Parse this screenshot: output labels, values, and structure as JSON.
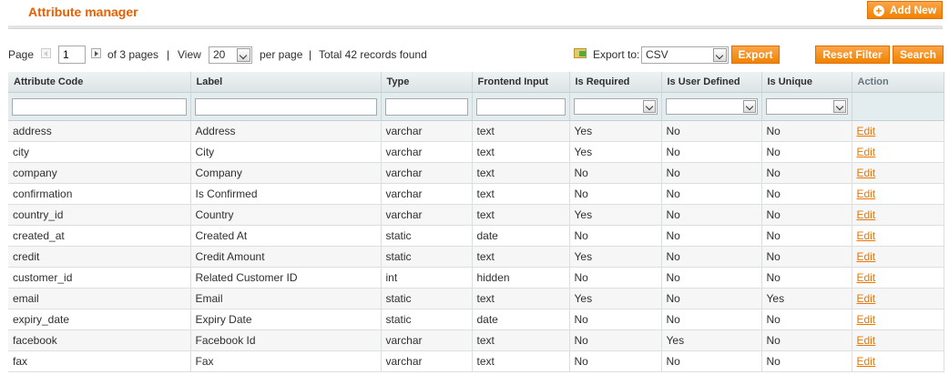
{
  "header": {
    "title": "Attribute manager",
    "add_new_label": "Add New"
  },
  "pager": {
    "page_label": "Page",
    "current_page": "1",
    "of_pages": "of 3 pages",
    "sep1": "|",
    "view_label": "View",
    "per_page_value": "20",
    "per_page_label": "per page",
    "sep2": "|",
    "total_records": "Total 42 records found"
  },
  "export": {
    "label": "Export to:",
    "format": "CSV",
    "button_label": "Export"
  },
  "actions": {
    "reset_filter_label": "Reset Filter",
    "search_label": "Search"
  },
  "columns": [
    "Attribute Code",
    "Label",
    "Type",
    "Frontend Input",
    "Is Required",
    "Is User Defined",
    "Is Unique",
    "Action"
  ],
  "rows": [
    {
      "code": "address",
      "label": "Address",
      "type": "varchar",
      "input": "text",
      "required": "Yes",
      "user_defined": "No",
      "unique": "No",
      "action": "Edit"
    },
    {
      "code": "city",
      "label": "City",
      "type": "varchar",
      "input": "text",
      "required": "Yes",
      "user_defined": "No",
      "unique": "No",
      "action": "Edit"
    },
    {
      "code": "company",
      "label": "Company",
      "type": "varchar",
      "input": "text",
      "required": "No",
      "user_defined": "No",
      "unique": "No",
      "action": "Edit"
    },
    {
      "code": "confirmation",
      "label": "Is Confirmed",
      "type": "varchar",
      "input": "text",
      "required": "No",
      "user_defined": "No",
      "unique": "No",
      "action": "Edit"
    },
    {
      "code": "country_id",
      "label": "Country",
      "type": "varchar",
      "input": "text",
      "required": "Yes",
      "user_defined": "No",
      "unique": "No",
      "action": "Edit"
    },
    {
      "code": "created_at",
      "label": "Created At",
      "type": "static",
      "input": "date",
      "required": "No",
      "user_defined": "No",
      "unique": "No",
      "action": "Edit"
    },
    {
      "code": "credit",
      "label": "Credit Amount",
      "type": "static",
      "input": "text",
      "required": "Yes",
      "user_defined": "No",
      "unique": "No",
      "action": "Edit"
    },
    {
      "code": "customer_id",
      "label": "Related Customer ID",
      "type": "int",
      "input": "hidden",
      "required": "No",
      "user_defined": "No",
      "unique": "No",
      "action": "Edit"
    },
    {
      "code": "email",
      "label": "Email",
      "type": "static",
      "input": "text",
      "required": "Yes",
      "user_defined": "No",
      "unique": "Yes",
      "action": "Edit"
    },
    {
      "code": "expiry_date",
      "label": "Expiry Date",
      "type": "static",
      "input": "date",
      "required": "No",
      "user_defined": "No",
      "unique": "No",
      "action": "Edit"
    },
    {
      "code": "facebook",
      "label": "Facebook Id",
      "type": "varchar",
      "input": "text",
      "required": "No",
      "user_defined": "Yes",
      "unique": "No",
      "action": "Edit"
    },
    {
      "code": "fax",
      "label": "Fax",
      "type": "varchar",
      "input": "text",
      "required": "No",
      "user_defined": "No",
      "unique": "No",
      "action": "Edit"
    }
  ],
  "colors": {
    "accent": "#eb5e00",
    "button": "#f18200",
    "link": "#ea7601"
  }
}
